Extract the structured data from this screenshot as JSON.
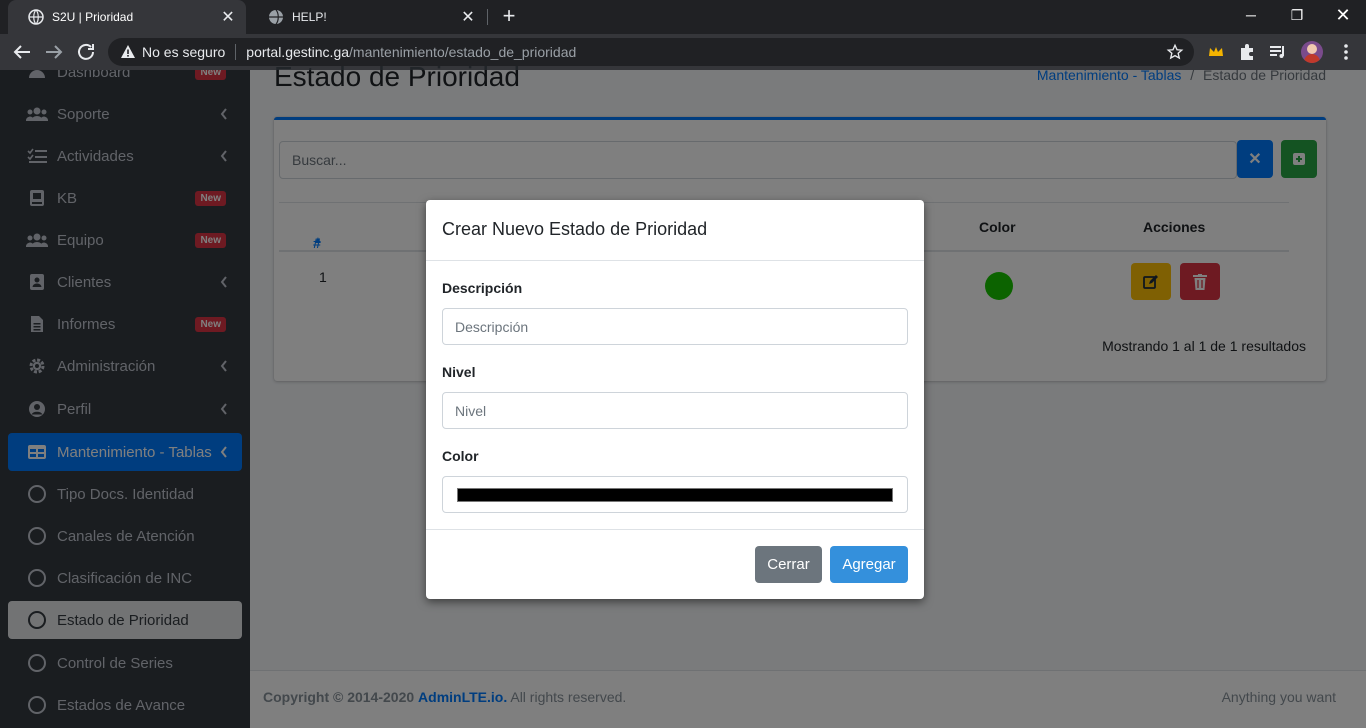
{
  "browser": {
    "tabs": [
      {
        "title": "S2U | Prioridad",
        "active": true
      },
      {
        "title": "HELP!",
        "active": false
      }
    ],
    "security_label": "No es seguro",
    "url_host": "portal.gestinc.ga",
    "url_path": "/mantenimiento/estado_de_prioridad"
  },
  "sidebar": {
    "items": [
      {
        "label": "Dashboard",
        "icon": "dashboard-icon",
        "badge": "New"
      },
      {
        "label": "Soporte",
        "icon": "users-icon",
        "chevron": true
      },
      {
        "label": "Actividades",
        "icon": "tasks-icon",
        "chevron": true
      },
      {
        "label": "KB",
        "icon": "book-icon",
        "badge": "New"
      },
      {
        "label": "Equipo",
        "icon": "team-icon",
        "badge": "New"
      },
      {
        "label": "Clientes",
        "icon": "contact-card-icon",
        "chevron": true
      },
      {
        "label": "Informes",
        "icon": "file-icon",
        "badge": "New"
      },
      {
        "label": "Administración",
        "icon": "gear-icon",
        "chevron": true
      },
      {
        "label": "Perfil",
        "icon": "user-circle-icon",
        "chevron": true
      },
      {
        "label": "Mantenimiento - Tablas",
        "icon": "table-icon",
        "chevron": true
      },
      {
        "label": "Tipo Docs. Identidad",
        "icon": "circle-icon"
      },
      {
        "label": "Canales de Atención",
        "icon": "circle-icon"
      },
      {
        "label": "Clasificación de INC",
        "icon": "circle-icon"
      },
      {
        "label": "Estado de Prioridad",
        "icon": "circle-icon"
      },
      {
        "label": "Control de Series",
        "icon": "circle-icon"
      },
      {
        "label": "Estados de Avance",
        "icon": "circle-icon"
      }
    ]
  },
  "page": {
    "title": "Estado de Prioridad",
    "breadcrumb_link": "Mantenimiento - Tablas",
    "breadcrumb_sep": "/",
    "breadcrumb_current": "Estado de Prioridad",
    "search_placeholder": "Buscar...",
    "table": {
      "headers": {
        "num": "#",
        "color": "Color",
        "actions": "Acciones"
      },
      "rows": [
        {
          "num": "1",
          "color": "#19c700"
        }
      ]
    },
    "showing": "Mostrando 1 al 1 de 1 resultados"
  },
  "footer": {
    "copyright": "Copyright © 2014-2020",
    "brand": "AdminLTE.io.",
    "rights": "All rights reserved.",
    "right_text": "Anything you want"
  },
  "modal": {
    "title": "Crear Nuevo Estado de Prioridad",
    "descripcion_label": "Descripción",
    "descripcion_placeholder": "Descripción",
    "nivel_label": "Nivel",
    "nivel_placeholder": "Nivel",
    "color_label": "Color",
    "color_value": "#000000",
    "close_label": "Cerrar",
    "add_label": "Agregar"
  },
  "colors": {
    "primary": "#007bff",
    "danger": "#dc3545",
    "success": "#28a745",
    "warning": "#ffc107",
    "sidebar_bg": "#343a40"
  }
}
